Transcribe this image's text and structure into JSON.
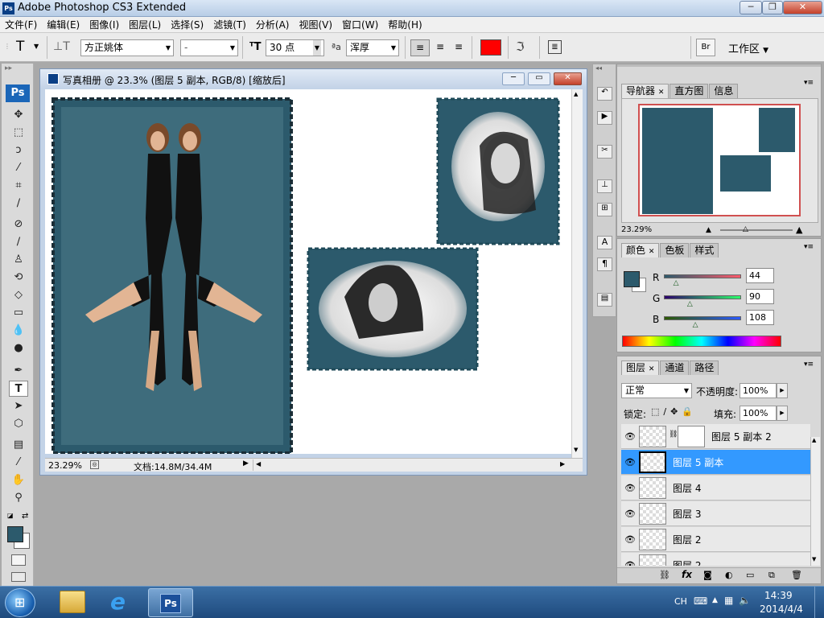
{
  "app": {
    "title": "Adobe Photoshop CS3 Extended",
    "icon_label": "Ps"
  },
  "menu": [
    "文件(F)",
    "编辑(E)",
    "图像(I)",
    "图层(L)",
    "选择(S)",
    "滤镜(T)",
    "分析(A)",
    "视图(V)",
    "窗口(W)",
    "帮助(H)"
  ],
  "options": {
    "tool_icon": "T",
    "font_family": "方正姚体",
    "font_style": "-",
    "font_size": "30 点",
    "aa_label": "ªa",
    "antialias": "浑厚",
    "text_color": "#ff0000",
    "workspace_label": "工作区"
  },
  "toolbox": {
    "ps_label": "Ps",
    "tools": [
      "move-tool",
      "marquee-tool",
      "lasso-tool",
      "magic-wand-tool",
      "crop-tool",
      "slice-tool",
      "healing-brush-tool",
      "brush-tool",
      "clone-stamp-tool",
      "history-brush-tool",
      "eraser-tool",
      "gradient-tool",
      "blur-tool",
      "dodge-tool",
      "pen-tool",
      "type-tool",
      "path-select-tool",
      "shape-tool",
      "notes-tool",
      "eyedropper-tool",
      "hand-tool",
      "zoom-tool"
    ],
    "fg_color": "#2c5a6c",
    "bg_color": "#ffffff"
  },
  "document": {
    "title": "写真相册 @ 23.3% (图层 5 副本, RGB/8) [缩放后]",
    "zoom": "23.29%",
    "doc_info": "文档:14.8M/34.4M",
    "frame_color": "#2c5a6c"
  },
  "navigator": {
    "tabs": [
      "导航器",
      "直方图",
      "信息"
    ],
    "zoom": "23.29%"
  },
  "color_panel": {
    "tabs": [
      "颜色",
      "色板",
      "样式"
    ],
    "r_label": "R",
    "g_label": "G",
    "b_label": "B",
    "r": 44,
    "g": 90,
    "b": 108,
    "swatch": "#2c5a6c"
  },
  "layers_panel": {
    "tabs": [
      "图层",
      "通道",
      "路径"
    ],
    "blend_mode": "正常",
    "opacity_label": "不透明度:",
    "opacity": "100%",
    "lock_label": "锁定:",
    "fill_label": "填充:",
    "fill": "100%",
    "layers": [
      {
        "name": "图层 5 副本 2",
        "selected": false
      },
      {
        "name": "图层 5 副本",
        "selected": true
      },
      {
        "name": "图层 4",
        "selected": false
      },
      {
        "name": "图层 3",
        "selected": false
      },
      {
        "name": "图层 2",
        "selected": false
      },
      {
        "name": "图层 2",
        "selected": false
      }
    ]
  },
  "taskbar": {
    "lang": "CH",
    "time": "14:39",
    "date": "2014/4/4",
    "ps_label": "Ps"
  }
}
